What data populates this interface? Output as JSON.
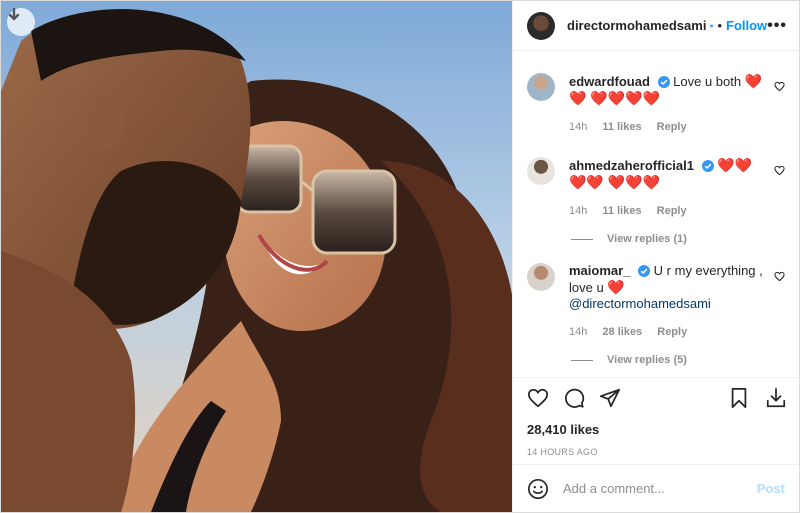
{
  "post": {
    "author": "directormohamedsami",
    "follow_label": "Follow",
    "more_label": "•••",
    "likes": "28,410 likes",
    "age": "14 HOURS AGO"
  },
  "comments": [
    {
      "user": "edwardfouad",
      "text": "Love u both",
      "hearts": "❤️❤️ ❤️❤️❤️❤️",
      "time": "14h",
      "likes": "11 likes",
      "reply": "Reply"
    },
    {
      "user": "ahmedzaherofficial1",
      "text": "",
      "hearts": "❤️❤️❤️❤️ ❤️❤️❤️",
      "time": "14h",
      "likes": "11 likes",
      "reply": "Reply",
      "view_replies": "View replies (1)"
    },
    {
      "user": "maiomar_",
      "text": "U r my everything , love u",
      "mention": "@directormohamedsami",
      "time": "14h",
      "likes": "28 likes",
      "reply": "Reply",
      "view_replies": "View replies (5)"
    }
  ],
  "composer": {
    "placeholder": "Add a comment...",
    "post_label": "Post"
  },
  "icons": {
    "download": "download-icon",
    "verified": "verified-badge-icon",
    "more": "more-options-icon",
    "heart": "heart-icon",
    "comment": "comment-icon",
    "share": "share-icon",
    "bookmark": "bookmark-icon",
    "save": "save-download-icon",
    "emoji": "emoji-icon"
  },
  "colors": {
    "accent": "#0095f6",
    "verified": "#3897f0",
    "heart": "#e0245e",
    "muted": "#8e8e8e"
  }
}
